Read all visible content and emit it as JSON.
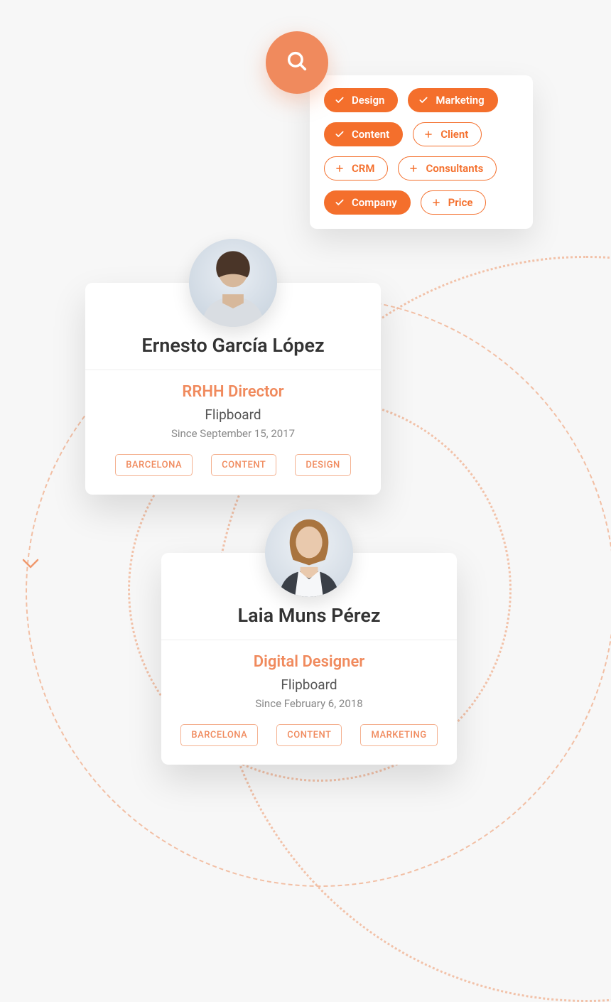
{
  "colors": {
    "accent": "#f46f2c",
    "accent_soft": "#f08a5d"
  },
  "filters": [
    {
      "label": "Design",
      "selected": true
    },
    {
      "label": "Marketing",
      "selected": true
    },
    {
      "label": "Content",
      "selected": true
    },
    {
      "label": "Client",
      "selected": false
    },
    {
      "label": "CRM",
      "selected": false
    },
    {
      "label": "Consultants",
      "selected": false
    },
    {
      "label": "Company",
      "selected": true
    },
    {
      "label": "Price",
      "selected": false
    }
  ],
  "profiles": [
    {
      "name": "Ernesto García López",
      "role": "RRHH Director",
      "company": "Flipboard",
      "since": "Since September 15, 2017",
      "tags": [
        "BARCELONA",
        "CONTENT",
        "DESIGN"
      ]
    },
    {
      "name": "Laia Muns Pérez",
      "role": "Digital Designer",
      "company": "Flipboard",
      "since": "Since February 6, 2018",
      "tags": [
        "BARCELONA",
        "CONTENT",
        "MARKETING"
      ]
    }
  ]
}
